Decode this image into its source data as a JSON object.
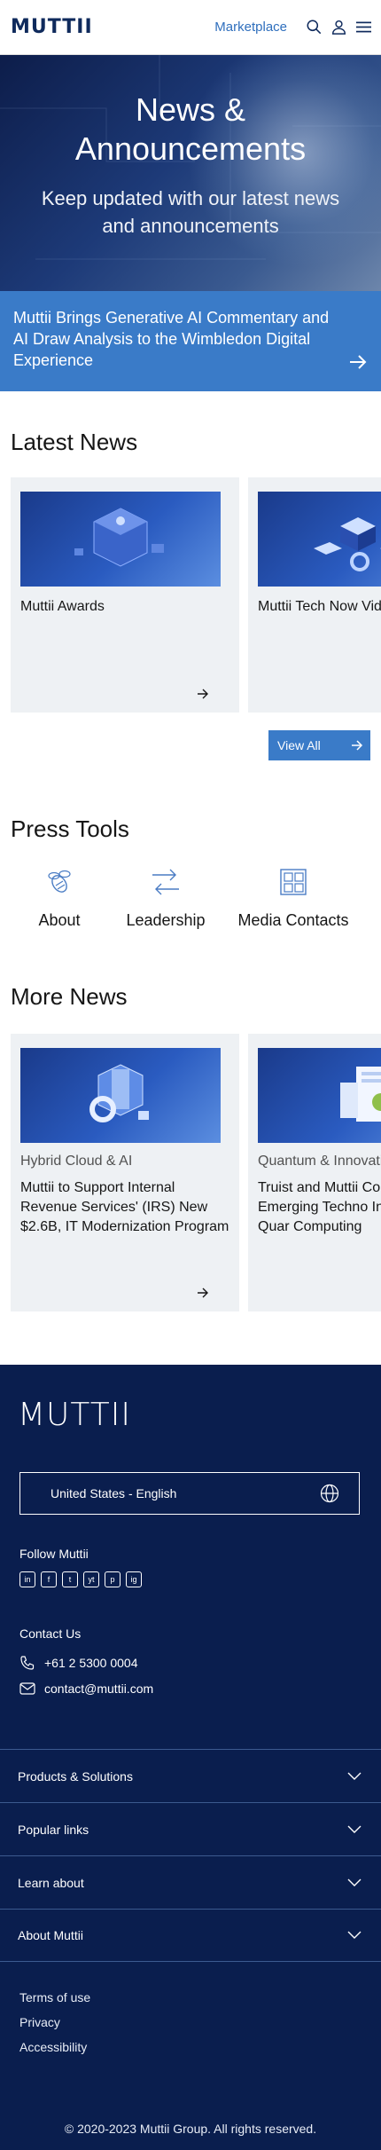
{
  "header": {
    "logo": "MUTTII",
    "nav_link": "Marketplace"
  },
  "hero": {
    "title_line1": "News &",
    "title_line2": "Announcements",
    "subtitle": "Keep updated with our latest news and announcements"
  },
  "banner": {
    "text": "Muttii Brings Generative AI Commentary and AI Draw Analysis to the Wimbledon Digital Experience"
  },
  "latest_news": {
    "heading": "Latest News",
    "cards": [
      {
        "title": "Muttii Awards"
      },
      {
        "title": "Muttii Tech Now Vide"
      }
    ],
    "view_all": "View All"
  },
  "press_tools": {
    "heading": "Press Tools",
    "items": [
      {
        "label": "About",
        "icon": "bee-icon"
      },
      {
        "label": "Leadership",
        "icon": "arrows-exchange-icon"
      },
      {
        "label": "Media Contacts",
        "icon": "contact-grid-icon"
      }
    ]
  },
  "more_news": {
    "heading": "More News",
    "cards": [
      {
        "category": "Hybrid Cloud & AI",
        "title": "Muttii to Support Internal Revenue Services' (IRS) New $2.6B, IT Modernization Program"
      },
      {
        "category": "Quantum & Innovatio",
        "title": "Truist and Muttii Coll on Emerging Techno Innovation and Quar Computing"
      }
    ]
  },
  "footer": {
    "logo": "MUTTII",
    "language": "United States - English",
    "follow_label": "Follow Muttii",
    "social": [
      "in",
      "f",
      "t",
      "yt",
      "p",
      "ig"
    ],
    "contact_label": "Contact Us",
    "phone": "+61 2 5300 0004",
    "email": "contact@muttii.com",
    "accordion": [
      "Products & Solutions",
      "Popular links",
      "Learn about",
      "About Muttii"
    ],
    "legal": [
      "Terms of use",
      "Privacy",
      "Accessibility"
    ],
    "copyright": "© 2020-2023 Muttii Group. All rights reserved."
  },
  "colors": {
    "brand_navy": "#0a1e4e",
    "accent_blue": "#3a7bc8",
    "card_bg": "#eef1f4"
  }
}
